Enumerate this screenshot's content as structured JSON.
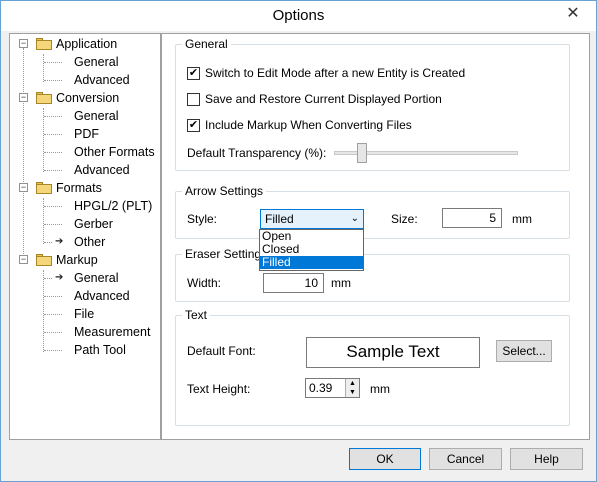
{
  "window": {
    "title": "Options",
    "close_glyph": "✕"
  },
  "tree": {
    "groups": [
      {
        "label": "Application",
        "children": [
          "General",
          "Advanced"
        ]
      },
      {
        "label": "Conversion",
        "children": [
          "General",
          "PDF",
          "Other Formats",
          "Advanced"
        ]
      },
      {
        "label": "Formats",
        "children": [
          "HPGL/2 (PLT)",
          "Gerber",
          "Other"
        ]
      },
      {
        "label": "Markup",
        "children": [
          "General",
          "Advanced",
          "File",
          "Measurement",
          "Path Tool"
        ]
      }
    ],
    "expander_glyph": "−",
    "arrow_glyph": "➔"
  },
  "general": {
    "title": "General",
    "opt1": {
      "label": "Switch to Edit Mode after a new Entity is Created",
      "checked": true
    },
    "opt2": {
      "label": "Save and Restore Current Displayed Portion",
      "checked": false
    },
    "opt3": {
      "label": "Include Markup When  Converting Files",
      "checked": true
    },
    "transparency_label": "Default Transparency (%):",
    "transparency_level": 0.13
  },
  "arrow": {
    "title": "Arrow Settings",
    "style_label": "Style:",
    "style_value": "Filled",
    "style_options": [
      "Open",
      "Closed",
      "Filled"
    ],
    "size_label": "Size:",
    "size_value": "5",
    "size_unit": "mm"
  },
  "eraser": {
    "title": "Eraser Settings",
    "width_label": "Width:",
    "width_value": "10",
    "width_unit": "mm"
  },
  "text": {
    "title": "Text",
    "font_label": "Default Font:",
    "font_sample": "Sample Text",
    "select_button": "Select...",
    "height_label": "Text Height:",
    "height_value": "0.39",
    "height_unit": "mm"
  },
  "footer": {
    "ok": "OK",
    "cancel": "Cancel",
    "help": "Help"
  },
  "checkmark": "✔",
  "spin_up": "▲",
  "spin_down": "▼",
  "chevron": "⌄"
}
